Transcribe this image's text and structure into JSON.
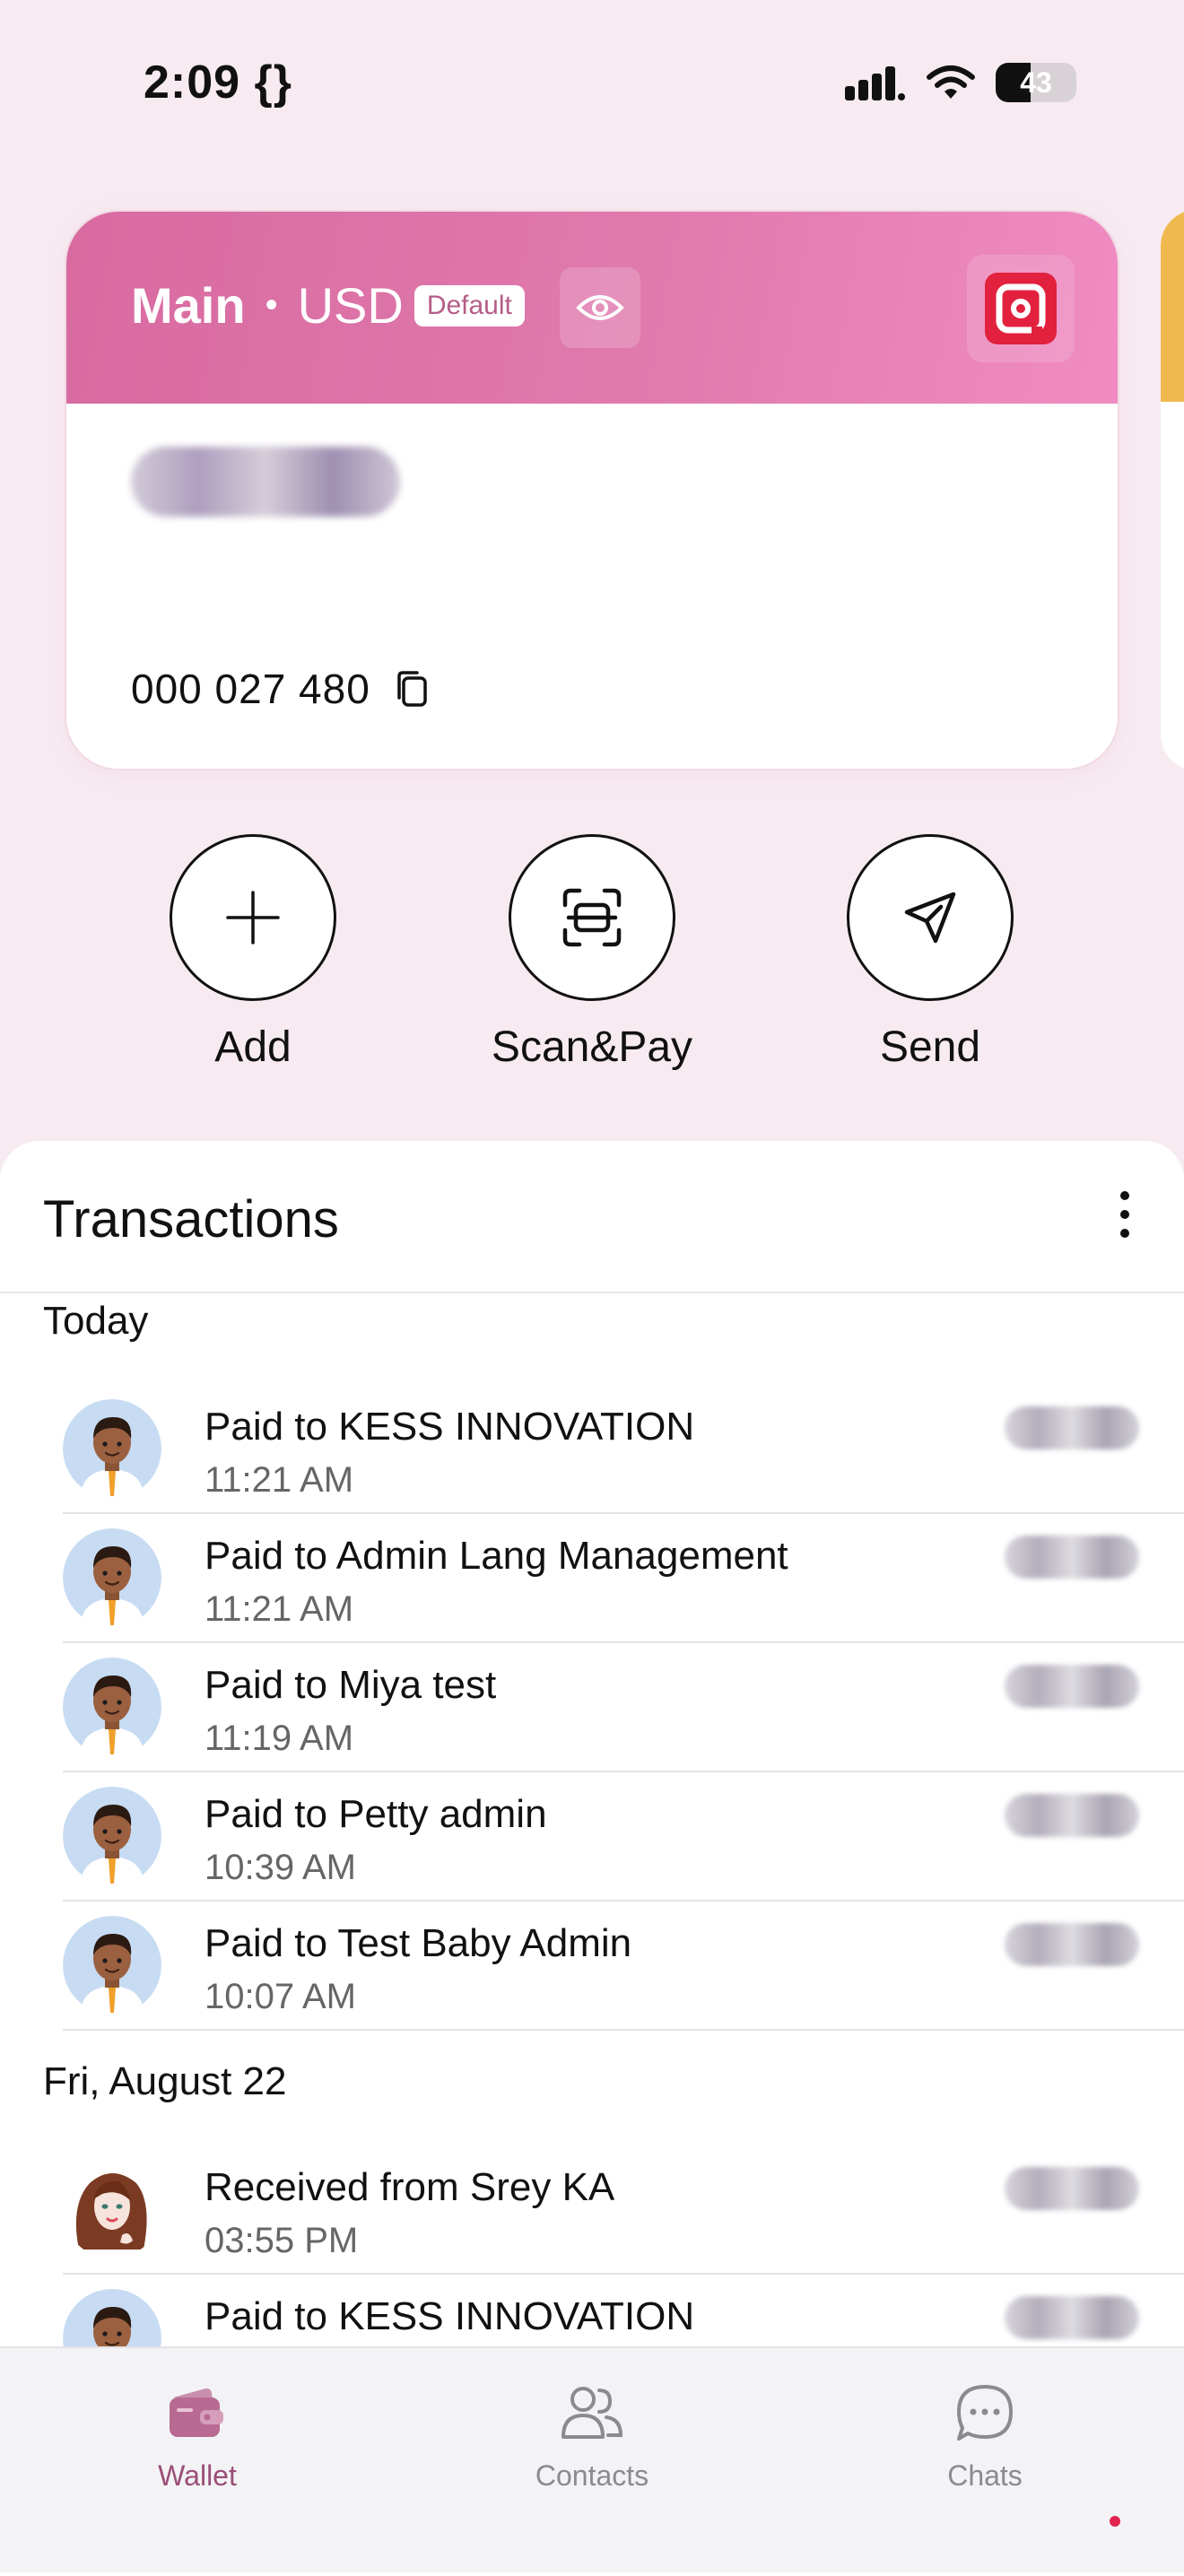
{
  "status_bar": {
    "time": "2:09 {}",
    "battery": "43",
    "battery_level": 0.43
  },
  "card": {
    "account_name": "Main",
    "separator": "•",
    "currency": "USD",
    "badge": "Default",
    "account_number": "000 027 480",
    "icons": [
      "eye-icon",
      "brand-logo-icon",
      "copy-icon"
    ],
    "colors": {
      "header_start": "#d86aa0",
      "header_end": "#f08cc2",
      "next_card": "#f0b94f"
    }
  },
  "actions": [
    {
      "label": "Add",
      "icon": "plus-icon"
    },
    {
      "label": "Scan&Pay",
      "icon": "scan-icon"
    },
    {
      "label": "Send",
      "icon": "send-icon"
    }
  ],
  "transactions": {
    "title": "Transactions",
    "groups": [
      {
        "label": "Today",
        "items": [
          {
            "name": "Paid to KESS INNOVATION",
            "time": "11:21 AM",
            "avatar": "male-avatar"
          },
          {
            "name": "Paid to Admin Lang Management",
            "time": "11:21 AM",
            "avatar": "male-avatar"
          },
          {
            "name": "Paid to Miya test",
            "time": "11:19 AM",
            "avatar": "male-avatar"
          },
          {
            "name": "Paid to Petty admin",
            "time": "10:39 AM",
            "avatar": "male-avatar"
          },
          {
            "name": "Paid to Test Baby Admin",
            "time": "10:07 AM",
            "avatar": "male-avatar"
          }
        ]
      },
      {
        "label": "Fri, August 22",
        "items": [
          {
            "name": "Received from Srey KA",
            "time": "03:55 PM",
            "avatar": "female-avatar"
          },
          {
            "name": "Paid to KESS INNOVATION",
            "time": "",
            "avatar": "male-avatar"
          }
        ]
      }
    ]
  },
  "nav": {
    "items": [
      {
        "label": "Wallet",
        "icon": "wallet-icon",
        "active": true
      },
      {
        "label": "Contacts",
        "icon": "contacts-icon",
        "active": false
      },
      {
        "label": "Chats",
        "icon": "chats-icon",
        "active": false
      }
    ],
    "active_color": "#9a4e78"
  }
}
